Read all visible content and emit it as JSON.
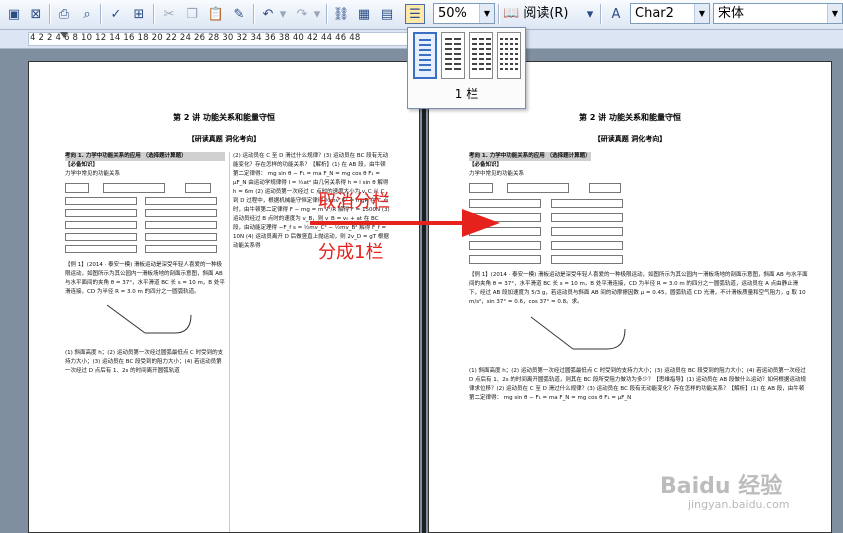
{
  "toolbar": {
    "zoom_value": "50%",
    "reading_label": "阅读(R)",
    "style_value": "Char2",
    "font_value": "宋体",
    "icons": [
      "save-icon",
      "permission-icon",
      "print-icon",
      "print-preview-icon",
      "spelling-icon",
      "research-icon",
      "cut-icon",
      "copy-icon",
      "paste-icon",
      "format-painter-icon",
      "undo-icon",
      "redo-icon",
      "hyperlink-icon",
      "tables-borders-icon",
      "insert-table-icon",
      "columns-icon",
      "styles-icon"
    ]
  },
  "ruler": {
    "ticks": "4  2     2   4   6   8  10  12  14  16  18  20  22  24  26  28  30  32  34  36  38  40  42  44  46  48"
  },
  "columns_popup": {
    "label": "1 栏",
    "options": [
      "1",
      "2",
      "3",
      "4"
    ]
  },
  "annotations": {
    "cancel": "取消分栏",
    "one_col": "分成1栏"
  },
  "page_left": {
    "title": "第 2 讲 功能关系和能量守恒",
    "subtitle": "【研读真题 洞化考向】",
    "col1_heading": "考向 1. 力学中功能关系的应用 （选择题计算题）",
    "col1_sub": "【必备知识】",
    "col1_line": "力学中常见的功能关系",
    "col1_example": "【例 1】(2014 · 泰安一模) 滑板运动是深受年轻人喜爱的一种极限运动，如图所示为其公园内一滑板场地的剖面示意图，斜面 AB 与水平面间的夹角 θ = 37°，水平滑道 BC 长 s = 10 m，B 处平滑连接，CD 为半径 R = 3.0 m 的四分之一圆弧轨道。",
    "col1_questions": "(1) 斜面高度 h；(2) 运动员第一次经过圆弧最低点 C 时受到的支持力大小；(3) 运动员在 BC 段受到的阻力大小；(4) 若运动员第一次经过 D 点后有 1、2s 的时间离开圆弧轨道",
    "col2_text": "(2) 运动员在 C 至 D 滑过什么规律？(3) 运动员在 BC 段有无动能变化？存在怎样的功能关系？【解析】(1) 在 AB 段，由牛顿第二定律得： mg sin θ − F₁ = ma  F_N = mg cos θ  F₁ = μF_N  由运动学规律得 l = ½at²  由几何关系得 h = l sin θ  解得 h = 6m  (2) 运动员第一次经过 C 点时的速度大小为 v_C  从 C 到 D 过程中，根据机械能守恒定律得  ½mv_C² = mgR  在 C 点时，由牛顿第二定律得  F − mg = m v²/R  解得 F = 1500N  (3) 运动员经过 B 点时的速度为 v_B，则 v_B = v₀ + at  在 BC 段，由动能定理得  −F_f s = ½mv_C² − ½mv_B²  解得 F_f = 10N  (4) 运动员离开 D 后做竖直上抛运动，则 2v_D = gT  根据动能关系得"
  },
  "page_right": {
    "title": "第 2 讲 功能关系和能量守恒",
    "subtitle": "【研读真题 洞化考向】",
    "heading": "考向 1. 力学中功能关系的应用 （选择题计算题）",
    "sub": "【必备知识】",
    "line": "力学中常见的功能关系",
    "example": "【例 1】(2014 · 泰安一模) 滑板运动是深受年轻人喜爱的一种极限运动，如图所示为其公园内一滑板场地的剖面示意图，斜面 AB 与水平面间的夹角 θ = 37°，水平滑道 BC 长 s = 10 m，B 处平滑连接，CD 为半径 R = 3.0 m 的四分之一圆弧轨道，运动员在 A 点由静止滑下，经过 AB 段加速度为 5/3 g，若运动员与斜面 AB 间的动摩擦因数 μ = 0.45，圆弧轨道 CD 光滑，不计滑板质量和空气阻力，g 取 10 m/s²，sin 37° = 0.6，cos 37° = 0.8。求。",
    "questions": "(1) 斜面高度 h；(2) 运动员第一次经过圆弧最低点 C 时受到的支持力大小；(3) 运动员在 BC 段受到的阻力大小；(4) 若运动员第一次经过 D 点后有 1、2s 的时间离开圆弧轨道，则其在 BC 段所受阻力做功为多少？【思维指导】(1) 运动员在 AB 段做什么运动？如何根据运动规律求位移？(2) 运动员在 C 至 D 滑过什么规律？(3) 运动员在 BC 段有无动能变化？存在怎样的功能关系？【解析】(1) 在 AB 段，由牛顿第二定律得： mg sin θ − F₁ = ma  F_N = mg cos θ  F₁ = μF_N"
  },
  "watermark": {
    "text": "Baidu 经验",
    "sub": "jingyan.baidu.com"
  }
}
